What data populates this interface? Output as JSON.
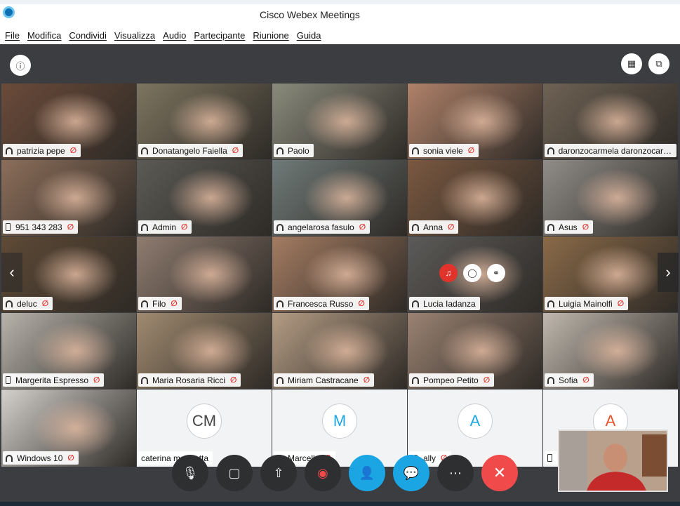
{
  "window": {
    "title": "Cisco Webex Meetings"
  },
  "menu": [
    "File",
    "Modifica",
    "Condividi",
    "Visualizza",
    "Audio",
    "Partecipante",
    "Riunione",
    "Guida"
  ],
  "participants": [
    {
      "name": "patrizia pepe",
      "device": "headset",
      "muted": true,
      "bg": "#6b4b3a"
    },
    {
      "name": "Donatangelo Faiella",
      "device": "headset",
      "muted": true,
      "bg": "#7d7560"
    },
    {
      "name": "Paolo",
      "device": "headset",
      "muted": false,
      "bg": "#8a8a7c"
    },
    {
      "name": "sonia viele",
      "device": "headset",
      "muted": true,
      "bg": "#b0826a"
    },
    {
      "name": "daronzocarmela daronzocarmela",
      "device": "headset",
      "muted": false,
      "bg": "#6e6254",
      "active": true
    },
    {
      "name": "951 343 283",
      "device": "phone",
      "muted": true,
      "bg": "#8c6e5a"
    },
    {
      "name": "Admin",
      "device": "headset",
      "muted": true,
      "bg": "#5b5a55"
    },
    {
      "name": "angelarosa fasulo",
      "device": "headset",
      "muted": true,
      "bg": "#6f7a78"
    },
    {
      "name": "Anna",
      "device": "headset",
      "muted": true,
      "bg": "#7a5840"
    },
    {
      "name": "Asus",
      "device": "headset",
      "muted": true,
      "bg": "#908c88"
    },
    {
      "name": "deluc",
      "device": "headset",
      "muted": true,
      "bg": "#5e4a36"
    },
    {
      "name": "Filo",
      "device": "headset",
      "muted": true,
      "bg": "#8f7c70"
    },
    {
      "name": "Francesca Russo",
      "device": "headset",
      "muted": true,
      "bg": "#a47c62"
    },
    {
      "name": "Lucia Iadanza",
      "device": "headset",
      "muted": false,
      "bg": "#5c5a58"
    },
    {
      "name": "Luigia Mainolfi",
      "device": "headset",
      "muted": true,
      "bg": "#8a6a48"
    },
    {
      "name": "Margerita Espresso",
      "device": "phone",
      "muted": true,
      "bg": "#b8b4ac"
    },
    {
      "name": "Maria Rosaria Ricci",
      "device": "headset",
      "muted": true,
      "bg": "#a08a70"
    },
    {
      "name": "Miriam Castracane",
      "device": "headset",
      "muted": true,
      "bg": "#b49c84"
    },
    {
      "name": "Pompeo Petito",
      "device": "headset",
      "muted": true,
      "bg": "#9a8272"
    },
    {
      "name": "Sofia",
      "device": "headset",
      "muted": true,
      "bg": "#c0b8ae"
    },
    {
      "name": "Windows 10",
      "device": "headset",
      "muted": true,
      "bg": "#d4d0cc"
    },
    {
      "name": "caterina mandetta",
      "device": "none",
      "muted": false,
      "initials": "CM",
      "initials_color": "#444444",
      "bg": "#f2f3f5"
    },
    {
      "name": "Marcella",
      "device": "headset",
      "muted": true,
      "initials": "M",
      "initials_color": "#1ba6e3",
      "bg": "#f2f3f5"
    },
    {
      "name": "ally",
      "device": "headset",
      "muted": true,
      "initials": "A",
      "initials_color": "#1ba6e3",
      "bg": "#f2f3f5"
    },
    {
      "name": "",
      "device": "phone",
      "muted": false,
      "initials": "A",
      "initials_color": "#e8542b",
      "bg": "#f2f3f5"
    }
  ],
  "colors": {
    "accent": "#1ba6e3",
    "mute": "#e0332b",
    "end": "#f04a4a",
    "stage": "#3b3d40"
  },
  "icons": {
    "info": "info-icon",
    "grid": "grid-layout-icon",
    "popout": "popout-icon",
    "mute": "microphone-icon",
    "video": "camera-icon",
    "share": "share-icon",
    "record": "record-icon",
    "participants": "participants-icon",
    "chat": "chat-icon",
    "more": "more-icon",
    "leave": "close-icon"
  }
}
